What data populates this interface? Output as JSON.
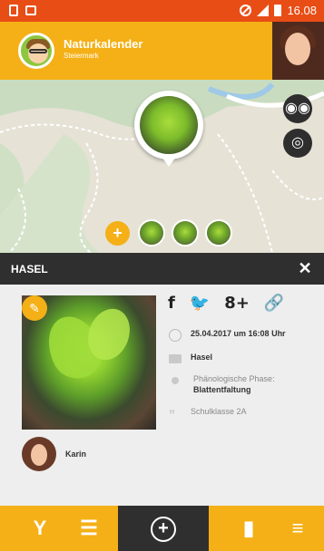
{
  "status_bar": {
    "time": "16.08",
    "icons": [
      "sim-icon",
      "image-icon",
      "do-not-disturb-icon",
      "signal-icon",
      "battery-icon"
    ]
  },
  "header": {
    "app_title": "Naturkalender",
    "app_subtitle": "Steiermark",
    "logo_icon": "app-logo-icon",
    "user_avatar": "user-avatar"
  },
  "map": {
    "controls": [
      "binoculars-icon",
      "locate-icon"
    ],
    "add_label": "+",
    "thumbnail_count": 3
  },
  "detail": {
    "title": "HASEL",
    "close_label": "✕",
    "share": {
      "facebook": "f",
      "twitter": "🐦",
      "google_plus": "8+",
      "link": "🔗"
    },
    "date": "25.04.2017 um 16:08 Uhr",
    "species": "Hasel",
    "phase_label": "Phänologische Phase:",
    "phase_value": "Blattentfaltung",
    "comment": "Schulklasse 2A",
    "author": "Karin"
  },
  "bottom_nav": {
    "filter_glyph": "Y",
    "list_glyph": "☰",
    "add_glyph": "+",
    "stats_glyph": "▮",
    "menu_glyph": "≡"
  },
  "colors": {
    "status_bar": "#e84d16",
    "accent": "#f4b016",
    "dark": "#2f2f2f",
    "background": "#eeeeee"
  }
}
